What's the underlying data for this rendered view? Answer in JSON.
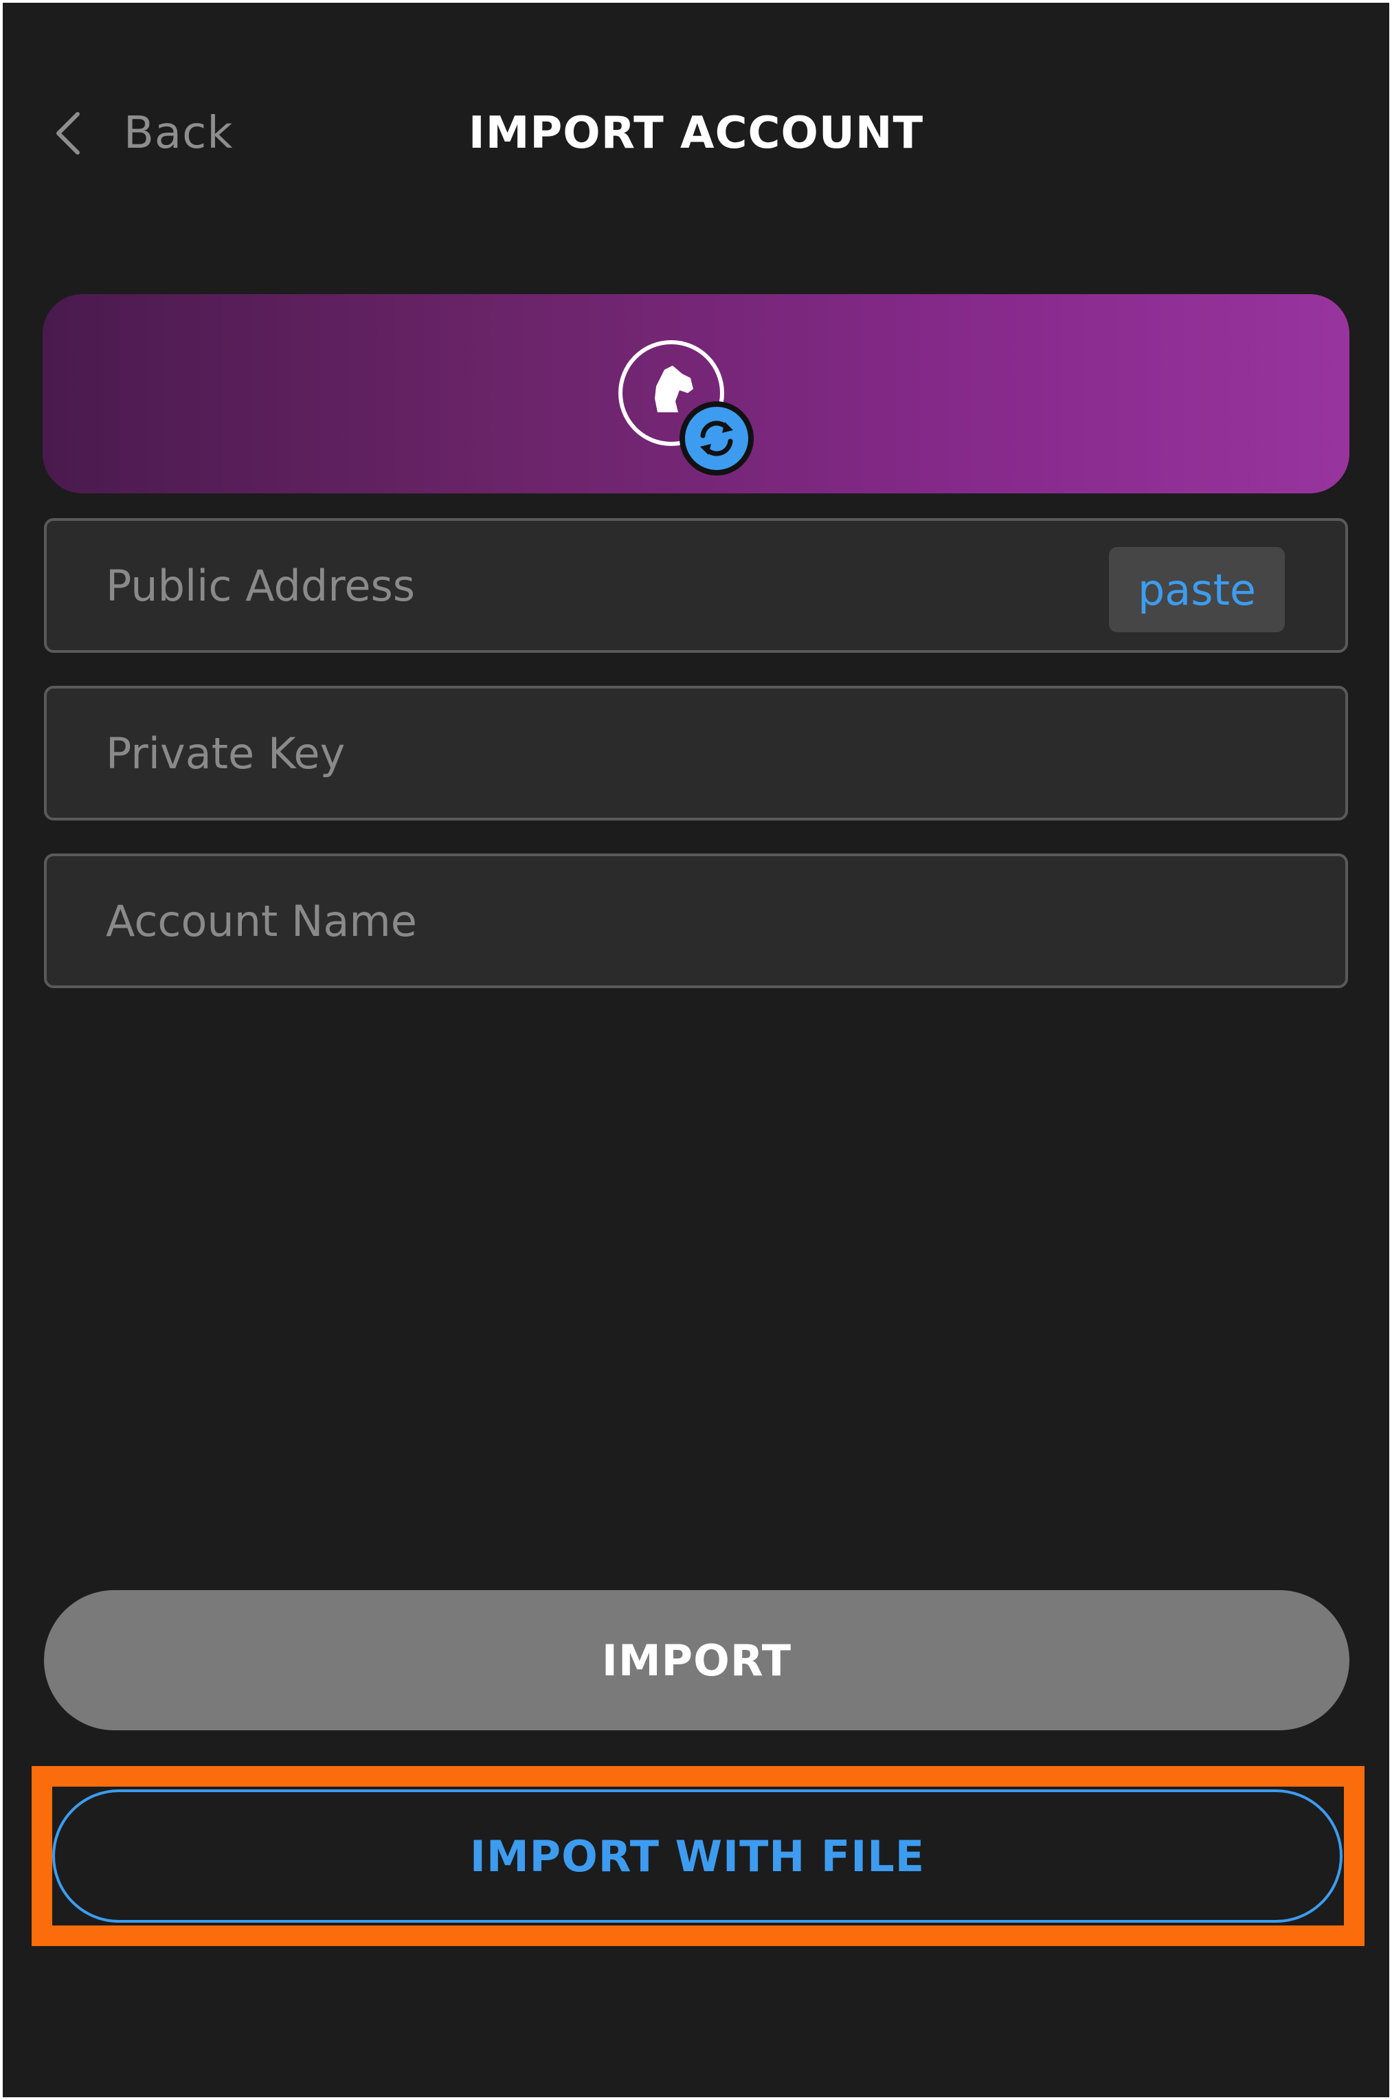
{
  "header": {
    "back_label": "Back",
    "title": "IMPORT ACCOUNT"
  },
  "banner": {
    "avatar_icon": "horse-avatar-icon",
    "badge_icon": "sync-icon",
    "accent_color": "#3d9cf0"
  },
  "form": {
    "public_address": {
      "placeholder": "Public Address",
      "value": "",
      "paste_label": "paste"
    },
    "private_key": {
      "placeholder": "Private Key",
      "value": ""
    },
    "account_name": {
      "placeholder": "Account Name",
      "value": ""
    }
  },
  "actions": {
    "import_label": "IMPORT",
    "import_with_file_label": "IMPORT WITH FILE"
  },
  "colors": {
    "background": "#1c1c1c",
    "accent": "#3d9cf0",
    "highlight": "#fa6c0c",
    "disabled_button": "#7a7a7a"
  }
}
